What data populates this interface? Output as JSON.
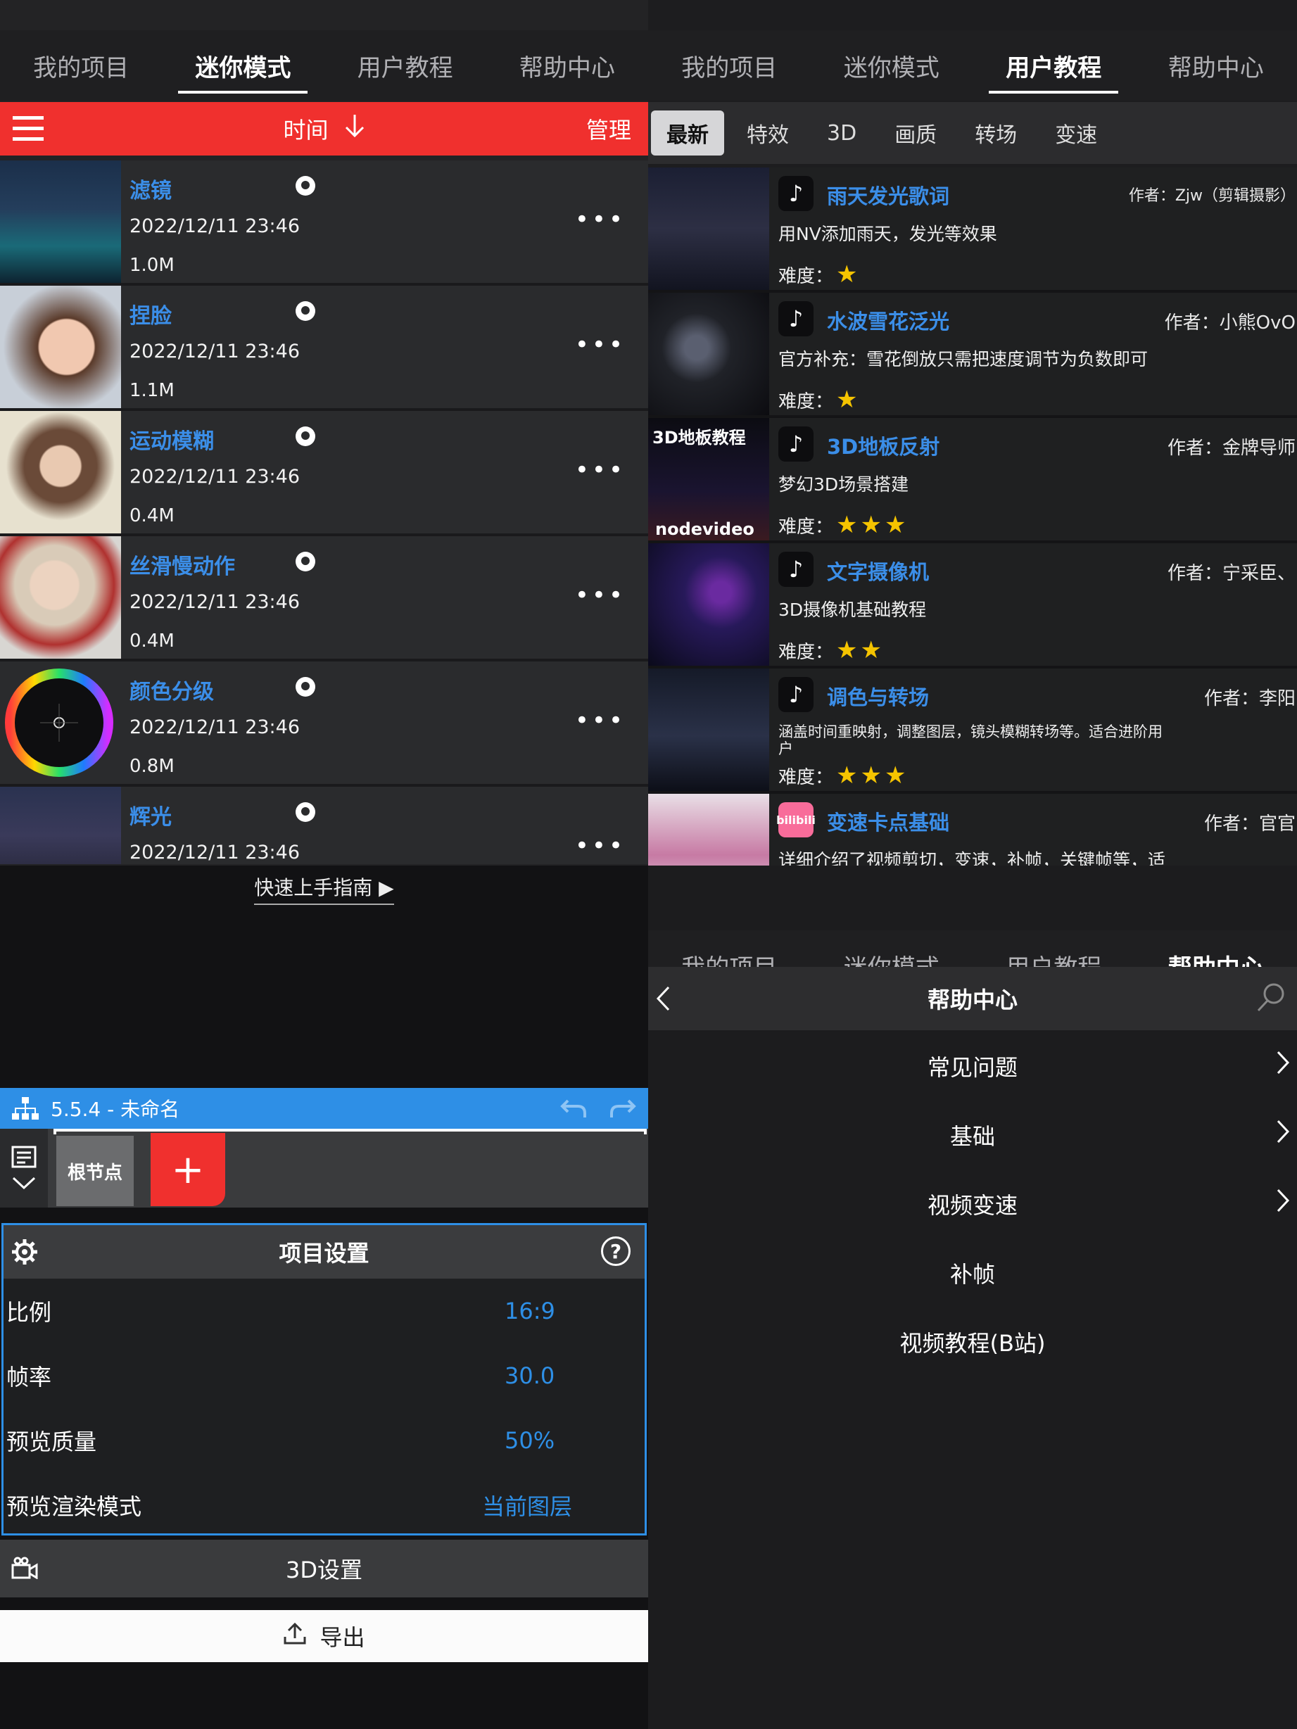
{
  "top_tabs": [
    "我的项目",
    "迷你模式",
    "用户教程",
    "帮助中心"
  ],
  "mini_mode": {
    "sort_label": "时间",
    "manage_label": "管理",
    "projects": [
      {
        "name": "滤镜",
        "date": "2022/12/11 23:46",
        "size": "1.0M",
        "more": "•••"
      },
      {
        "name": "捏脸",
        "date": "2022/12/11 23:46",
        "size": "1.1M",
        "more": "•••"
      },
      {
        "name": "运动模糊",
        "date": "2022/12/11 23:46",
        "size": "0.4M",
        "more": "•••"
      },
      {
        "name": "丝滑慢动作",
        "date": "2022/12/11 23:46",
        "size": "0.4M",
        "more": "•••"
      },
      {
        "name": "颜色分级",
        "date": "2022/12/11 23:46",
        "size": "0.8M",
        "more": "•••"
      },
      {
        "name": "辉光",
        "date": "2022/12/11 23:46",
        "size": "",
        "more": "•••"
      }
    ]
  },
  "tutorials": {
    "filters": [
      "最新",
      "特效",
      "3D",
      "画质",
      "转场",
      "变速"
    ],
    "items": [
      {
        "title": "雨天发光歌词",
        "author": "作者：Zjw（剪辑摄影）",
        "desc": "用NV添加雨天，发光等效果",
        "difficulty_label": "难度：",
        "stars": 1,
        "thumb_text": "",
        "platform": "tiktok"
      },
      {
        "title": "水波雪花泛光",
        "author": "作者：小熊OvO",
        "desc": "官方补充：雪花倒放只需把速度调节为负数即可",
        "difficulty_label": "难度：",
        "stars": 1,
        "thumb_text": "",
        "platform": "tiktok"
      },
      {
        "title": "3D地板反射",
        "author": "作者：金牌导师",
        "desc": "梦幻3D场景搭建",
        "difficulty_label": "难度：",
        "stars": 3,
        "thumb_text": "3D地板教程",
        "thumb_text2": "nodevideo",
        "platform": "tiktok"
      },
      {
        "title": "文字摄像机",
        "author": "作者：宁采臣、",
        "desc": "3D摄像机基础教程",
        "difficulty_label": "难度：",
        "stars": 2,
        "thumb_text": "",
        "platform": "tiktok"
      },
      {
        "title": "调色与转场",
        "author": "作者：李阳",
        "desc": "涵盖时间重映射，调整图层，镜头模糊转场等。适合进阶用户",
        "difficulty_label": "难度：",
        "stars": 3,
        "thumb_text": "",
        "platform": "tiktok"
      },
      {
        "title": "变速卡点基础",
        "author": "作者：官官",
        "desc": "详细介绍了视频剪切，变速，补帧，关键帧等，适合新手",
        "difficulty_label": "",
        "stars": 0,
        "thumb_text": "",
        "platform": "bilibili"
      }
    ]
  },
  "editor": {
    "guide_link": "快速上手指南 ▶",
    "project_title": "5.5.4 - 未命名",
    "root_node": "根节点",
    "add_symbol": "+",
    "settings_title": "项目设置",
    "settings": [
      {
        "label": "比例",
        "value": "16:9"
      },
      {
        "label": "帧率",
        "value": "30.0"
      },
      {
        "label": "预览质量",
        "value": "50%"
      },
      {
        "label": "预览渲染模式",
        "value": "当前图层"
      }
    ],
    "settings_3d": "3D设置",
    "export": "导出"
  },
  "help_center": {
    "title": "帮助中心",
    "items": [
      {
        "label": "常见问题",
        "chevron": true
      },
      {
        "label": "基础",
        "chevron": true
      },
      {
        "label": "视频变速",
        "chevron": true
      },
      {
        "label": "补帧",
        "chevron": false
      },
      {
        "label": "视频教程(B站)",
        "chevron": false
      }
    ]
  },
  "colors": {
    "accent_red": "#f0302e",
    "accent_blue": "#2e8fe6",
    "link_blue": "#3b8ee8",
    "star": "#f5c400"
  }
}
